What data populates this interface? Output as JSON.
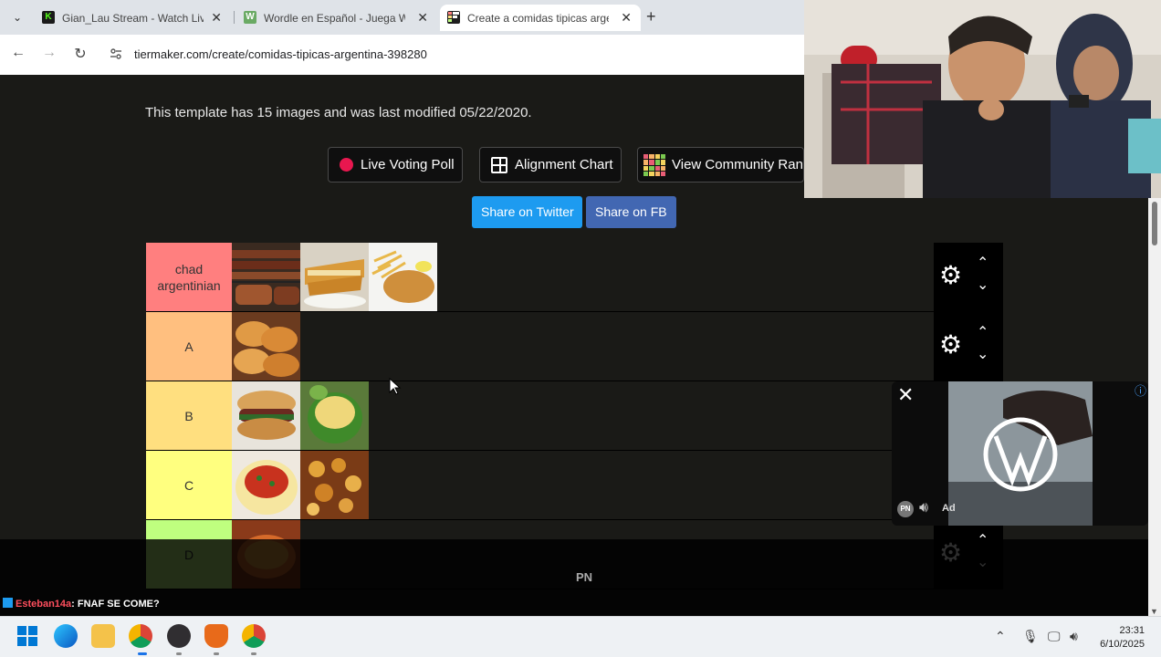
{
  "browser": {
    "tabs": [
      {
        "title": "Gian_Lau Stream - Watch Live o",
        "icon_color": "#53fc18",
        "icon_letter": "K"
      },
      {
        "title": "Wordle en Español - Juega Wor",
        "icon_color": "#6aaa64",
        "icon_letter": "W"
      },
      {
        "title": "Create a comidas tipicas argent",
        "icon_color": "#1f1f1f",
        "icon_letter": "T"
      }
    ],
    "url": "tiermaker.com/create/comidas-tipicas-argentina-398280"
  },
  "page": {
    "template_info": "This template has 15 images and was last modified 05/22/2020.",
    "buttons": {
      "live_voting": "Live Voting Poll",
      "alignment": "Alignment Chart",
      "community": "View Community Ran",
      "twitter": "Share on Twitter",
      "facebook": "Share on FB"
    },
    "tiers": [
      {
        "label": "chad argentinian",
        "color": "#ff7f7f",
        "items": 3
      },
      {
        "label": "A",
        "color": "#ffbf7f",
        "items": 1
      },
      {
        "label": "B",
        "color": "#ffdf7f",
        "items": 2
      },
      {
        "label": "C",
        "color": "#ffff7f",
        "items": 2
      },
      {
        "label": "D",
        "color": "#bfff7f",
        "items": 1
      }
    ]
  },
  "ad": {
    "label": "Ad",
    "brand_badge": "PN"
  },
  "overlay": {
    "center_text": "PN",
    "chat": {
      "user": "Esteban14a",
      "message": ": FNAF SE COME?"
    }
  },
  "taskbar": {
    "time": "23:31",
    "date": "6/10/2025"
  }
}
